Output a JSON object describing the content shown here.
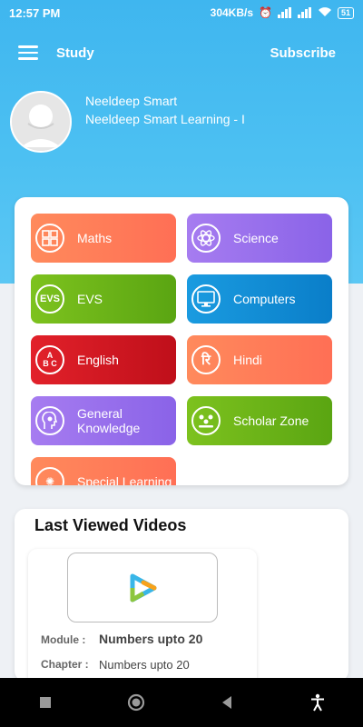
{
  "status_bar": {
    "time": "12:57 PM",
    "speed": "304KB/s",
    "battery": "51"
  },
  "app_bar": {
    "title": "Study",
    "action": "Subscribe"
  },
  "profile": {
    "name": "Neeldeep Smart",
    "subtitle": "Neeldeep Smart Learning - I"
  },
  "subjects": [
    {
      "label": "Maths",
      "icon": "calculator-icon",
      "color_from": "#ff8a5c",
      "color_to": "#ff6f55"
    },
    {
      "label": "Science",
      "icon": "atom-icon",
      "color_from": "#a67cf0",
      "color_to": "#8a63e8"
    },
    {
      "label": "EVS",
      "icon": "evs-icon",
      "color_from": "#7dc21e",
      "color_to": "#5aa512"
    },
    {
      "label": "Computers",
      "icon": "monitor-icon",
      "color_from": "#1a9be0",
      "color_to": "#0a7ec9"
    },
    {
      "label": "English",
      "icon": "abc-icon",
      "color_from": "#e2212a",
      "color_to": "#bf0f1a"
    },
    {
      "label": "Hindi",
      "icon": "hindi-letter-icon",
      "color_from": "#ff8a5c",
      "color_to": "#ff6f55"
    },
    {
      "label": "General Knowledge",
      "icon": "brain-head-icon",
      "color_from": "#a67cf0",
      "color_to": "#8a63e8"
    },
    {
      "label": "Scholar Zone",
      "icon": "group-icon",
      "color_from": "#7dc21e",
      "color_to": "#5aa512"
    },
    {
      "label": "Special Learning",
      "icon": "special-icon",
      "color_from": "#ff8a5c",
      "color_to": "#ff6f55"
    }
  ],
  "last_viewed": {
    "title": "Last Viewed Videos",
    "module_label": "Module :",
    "module_value": "Numbers upto 20",
    "chapter_label": "Chapter :",
    "chapter_value": "Numbers upto 20"
  }
}
